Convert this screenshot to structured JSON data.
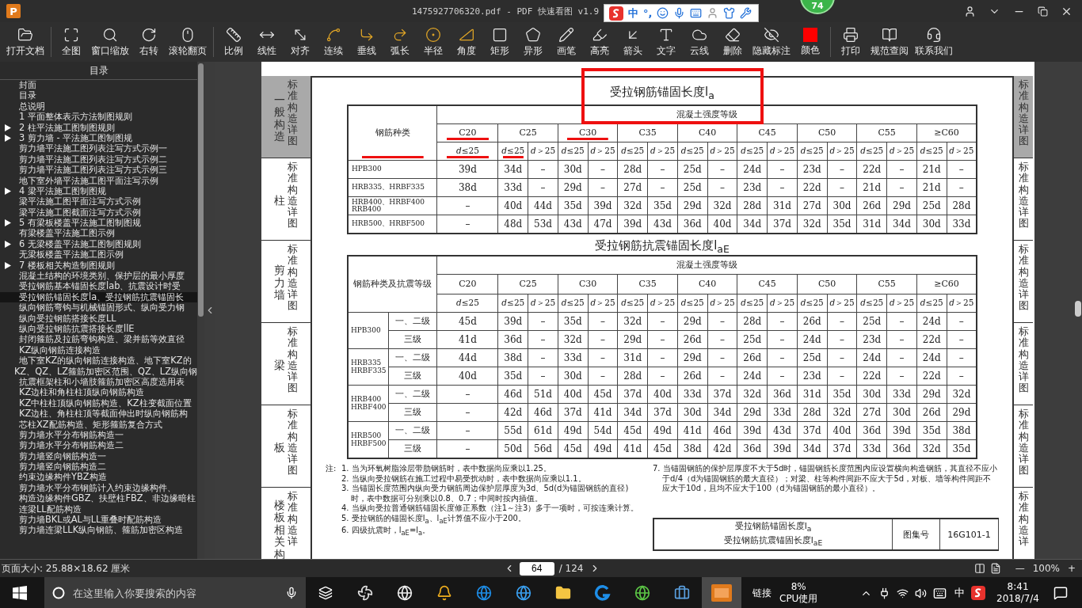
{
  "window": {
    "logo": "P",
    "title": "1475927706320.pdf - PDF 快速看图 v1.9",
    "badge": "74"
  },
  "ime_bar": {
    "mode": "中",
    "punct": "°,"
  },
  "toolbar": {
    "groups": [
      [
        {
          "label": "打开文档"
        }
      ],
      [
        {
          "label": "全图"
        },
        {
          "label": "窗口缩放"
        },
        {
          "label": "右转"
        },
        {
          "label": "滚轮翻页"
        }
      ],
      [
        {
          "label": "比例"
        },
        {
          "label": "线性"
        },
        {
          "label": "对齐"
        },
        {
          "label": "连续"
        },
        {
          "label": "垂线"
        },
        {
          "label": "弧长"
        },
        {
          "label": "半径"
        },
        {
          "label": "角度"
        },
        {
          "label": "矩形"
        },
        {
          "label": "异形"
        },
        {
          "label": "画笔"
        },
        {
          "label": "高亮"
        },
        {
          "label": "箭头"
        },
        {
          "label": "文字"
        },
        {
          "label": "云线"
        },
        {
          "label": "删除"
        },
        {
          "label": "隐藏标注"
        },
        {
          "label": "颜色",
          "color": "#ff0000"
        }
      ],
      [
        {
          "label": "打印"
        },
        {
          "label": "规范查阅"
        },
        {
          "label": "联系我们"
        }
      ]
    ]
  },
  "sidebar": {
    "title": "目录",
    "items": [
      {
        "label": "封面",
        "kind": "page",
        "selected": false
      },
      {
        "label": "目录",
        "kind": "page",
        "selected": false
      },
      {
        "label": "总说明",
        "kind": "page",
        "selected": false
      },
      {
        "label": "1 平面整体表示方法制图规则",
        "kind": "page",
        "selected": false
      },
      {
        "label": "2 柱平法施工图制图规则",
        "kind": "section",
        "expanded": false,
        "selected": false
      },
      {
        "label": "3 剪力墙 - 平法施工图制图规",
        "kind": "section",
        "expanded": false,
        "selected": false
      },
      {
        "label": "剪力墙平法施工图列表注写方式示例一",
        "kind": "page",
        "selected": false
      },
      {
        "label": "剪力墙平法施工图列表注写方式示例二",
        "kind": "page",
        "selected": false
      },
      {
        "label": "剪力墙平法施工图列表注写方式示例三",
        "kind": "page",
        "selected": false
      },
      {
        "label": "地下室外墙平法施工图平面注写示例",
        "kind": "page",
        "selected": false
      },
      {
        "label": "4 梁平法施工图制图规",
        "kind": "section",
        "expanded": false,
        "selected": false
      },
      {
        "label": "梁平法施工图平面注写方式示例",
        "kind": "page",
        "selected": false
      },
      {
        "label": "梁平法施工图截面注写方式示例",
        "kind": "page",
        "selected": false
      },
      {
        "label": "5 有梁板楼盖平法施工图制图规",
        "kind": "section",
        "expanded": false,
        "selected": false
      },
      {
        "label": "有梁楼盖平法施工图示例",
        "kind": "page",
        "selected": false
      },
      {
        "label": "6 无梁楼盖平法施工图制图规则",
        "kind": "section",
        "expanded": false,
        "selected": false
      },
      {
        "label": "无梁板楼盖平法施工图示例",
        "kind": "page",
        "selected": false
      },
      {
        "label": "7 楼板相关构造制图规则",
        "kind": "section",
        "expanded": false,
        "selected": false
      },
      {
        "label": "混凝土结构的环境类别、保护层的最小厚度",
        "kind": "page",
        "selected": false
      },
      {
        "label": "受拉钢筋基本锚固长度lab、抗震设计时受",
        "kind": "page",
        "selected": false
      },
      {
        "label": "受拉钢筋锚固长度la、受拉钢筋抗震锚固长",
        "kind": "page",
        "selected": true
      },
      {
        "label": "纵向钢筋弯钩与机械锚固形式、纵向受力钢",
        "kind": "page",
        "selected": false
      },
      {
        "label": "纵向受拉钢筋搭接长度LL",
        "kind": "page",
        "selected": false
      },
      {
        "label": "纵向受拉钢筋抗震搭接长度llE",
        "kind": "page",
        "selected": false
      },
      {
        "label": "封闭箍筋及拉筋弯钩构造、梁并筋等效直径",
        "kind": "page",
        "selected": false
      },
      {
        "label": "KZ纵向钢筋连接构造",
        "kind": "page",
        "selected": false
      },
      {
        "label": "地下室KZ的纵向钢筋连接构造、地下室KZ的",
        "kind": "page",
        "selected": false
      },
      {
        "label": "KZ、QZ、LZ箍筋加密区范围、QZ、LZ纵向钢",
        "kind": "page",
        "selected": false
      },
      {
        "label": "抗震框架柱和小墙肢箍筋加密区高度选用表",
        "kind": "page",
        "selected": false
      },
      {
        "label": "KZ边柱和角柱柱顶纵向钢筋构造",
        "kind": "page",
        "selected": false
      },
      {
        "label": "KZ中柱柱顶纵向钢筋构造、KZ柱变截面位置",
        "kind": "page",
        "selected": false
      },
      {
        "label": "KZ边柱、角柱柱顶等截面伸出时纵向钢筋构",
        "kind": "page",
        "selected": false
      },
      {
        "label": "芯柱XZ配筋构造、矩形箍筋复合方式",
        "kind": "page",
        "selected": false
      },
      {
        "label": "剪力墙水平分布钢筋构造一",
        "kind": "page",
        "selected": false
      },
      {
        "label": "剪力墙水平分布钢筋构造二",
        "kind": "page",
        "selected": false
      },
      {
        "label": "剪力墙竖向钢筋构造一",
        "kind": "page",
        "selected": false
      },
      {
        "label": "剪力墙竖向钢筋构造二",
        "kind": "page",
        "selected": false
      },
      {
        "label": "约束边缘构件YBZ构造",
        "kind": "page",
        "selected": false
      },
      {
        "label": "剪力墙水平分布钢筋计入约束边缘构件、",
        "kind": "page",
        "selected": false
      },
      {
        "label": "构造边缘构件GBZ、扶壁柱FBZ、非边缘暗柱",
        "kind": "page",
        "selected": false
      },
      {
        "label": "连梁LL配筋构造",
        "kind": "page",
        "selected": false
      },
      {
        "label": "剪力墙BKL或AL与LL重叠时配筋构造",
        "kind": "page",
        "selected": false
      },
      {
        "label": "剪力墙连梁LLK纵向钢筋、箍筋加密区构造",
        "kind": "page",
        "selected": false
      }
    ]
  },
  "document": {
    "left_tabs": [
      {
        "category": "一般构造",
        "label": "标准构造详图",
        "selected": true
      },
      {
        "category": "柱",
        "label": "标准构造详图",
        "selected": false
      },
      {
        "category": "剪力墙",
        "label": "标准构造详图",
        "selected": false
      },
      {
        "category": "梁",
        "label": "标准构造详图",
        "selected": false
      },
      {
        "category": "板",
        "label": "标准构造详图",
        "selected": false
      },
      {
        "category": "楼板相关构",
        "label": "标准构造详",
        "selected": false
      }
    ],
    "right_tabs": [
      {
        "label": "标准构造详图",
        "selected": true
      },
      {
        "label": "标准构造详图",
        "selected": false
      },
      {
        "label": "标准构造详图",
        "selected": false
      },
      {
        "label": "标准构造详图",
        "selected": false
      },
      {
        "label": "标准构造详图",
        "selected": false
      },
      {
        "label": "标准构造详",
        "selected": false
      }
    ],
    "table1": {
      "title": "受拉钢筋锚固长度l$_{a}$",
      "annotated": true,
      "row_header": {
        "label": "钢筋种类",
        "marked": true
      },
      "group_header": "混凝土强度等级",
      "grades": [
        {
          "label": "C20",
          "marked": true,
          "subs": [
            {
              "label": "*d*≤25",
              "marked": true
            }
          ]
        },
        {
          "label": "C25",
          "marked": false,
          "subs": [
            {
              "label": "*d*≤25",
              "marked": true
            },
            {
              "label": "*d*＞25",
              "marked": false
            }
          ]
        },
        {
          "label": "C30",
          "marked": true,
          "subs": [
            {
              "label": "*d*≤25",
              "marked": false
            },
            {
              "label": "*d*＞25",
              "marked": false
            }
          ]
        },
        {
          "label": "C35",
          "marked": false,
          "subs": [
            {
              "label": "*d*≤25",
              "marked": false
            },
            {
              "label": "*d*＞25",
              "marked": false
            }
          ]
        },
        {
          "label": "C40",
          "marked": false,
          "subs": [
            {
              "label": "*d*≤25",
              "marked": false
            },
            {
              "label": "*d*＞25",
              "marked": false
            }
          ]
        },
        {
          "label": "C45",
          "marked": false,
          "subs": [
            {
              "label": "*d*≤25",
              "marked": false
            },
            {
              "label": "*d*＞25",
              "marked": false
            }
          ]
        },
        {
          "label": "C50",
          "marked": false,
          "subs": [
            {
              "label": "*d*≤25",
              "marked": false
            },
            {
              "label": "*d*＞25",
              "marked": false
            }
          ]
        },
        {
          "label": "C55",
          "marked": false,
          "subs": [
            {
              "label": "*d*≤25",
              "marked": false
            },
            {
              "label": "*d*＞25",
              "marked": false
            }
          ]
        },
        {
          "label": "≥C60",
          "marked": false,
          "subs": [
            {
              "label": "*d*≤25",
              "marked": false
            },
            {
              "label": "*d*＞25",
              "marked": false
            }
          ]
        }
      ],
      "rows": [
        {
          "name": "HPB300",
          "values": [
            "39d",
            "34d",
            "–",
            "30d",
            "–",
            "28d",
            "–",
            "25d",
            "–",
            "24d",
            "–",
            "23d",
            "–",
            "22d",
            "–",
            "21d",
            "–"
          ]
        },
        {
          "name": "HRB335、HRBF335",
          "values": [
            "38d",
            "33d",
            "–",
            "29d",
            "–",
            "27d",
            "–",
            "25d",
            "–",
            "23d",
            "–",
            "22d",
            "–",
            "21d",
            "–",
            "21d",
            "–"
          ]
        },
        {
          "name": "HRB400、HRBF400\nRRB400",
          "values": [
            "–",
            "40d",
            "44d",
            "35d",
            "39d",
            "32d",
            "35d",
            "29d",
            "32d",
            "28d",
            "31d",
            "27d",
            "30d",
            "26d",
            "29d",
            "25d",
            "28d"
          ]
        },
        {
          "name": "HRB500、HRBF500",
          "values": [
            "–",
            "48d",
            "53d",
            "43d",
            "47d",
            "39d",
            "43d",
            "36d",
            "40d",
            "34d",
            "37d",
            "32d",
            "35d",
            "31d",
            "34d",
            "30d",
            "33d"
          ]
        }
      ]
    },
    "table2": {
      "title": "受拉钢筋抗震锚固长度l$_{aE}$",
      "row_header": "钢筋种类及抗震等级",
      "group_header": "混凝土强度等级",
      "grades": [
        {
          "label": "C20",
          "subs": [
            "*d*≤25"
          ]
        },
        {
          "label": "C25",
          "subs": [
            "*d*≤25",
            "*d*＞25"
          ]
        },
        {
          "label": "C30",
          "subs": [
            "*d*≤25",
            "*d*＞25"
          ]
        },
        {
          "label": "C35",
          "subs": [
            "*d*≤25",
            "*d*＞25"
          ]
        },
        {
          "label": "C40",
          "subs": [
            "*d*≤25",
            "*d*＞25"
          ]
        },
        {
          "label": "C45",
          "subs": [
            "*d*≤25",
            "*d*＞25"
          ]
        },
        {
          "label": "C50",
          "subs": [
            "*d*≤25",
            "*d*＞25"
          ]
        },
        {
          "label": "C55",
          "subs": [
            "*d*≤25",
            "*d*＞25"
          ]
        },
        {
          "label": "≥C60",
          "subs": [
            "*d*≤25",
            "*d*＞25"
          ]
        }
      ],
      "groups": [
        {
          "name": "HPB300",
          "rows": [
            {
              "level": "一、二级",
              "values": [
                "45d",
                "39d",
                "–",
                "35d",
                "–",
                "32d",
                "–",
                "29d",
                "–",
                "28d",
                "–",
                "26d",
                "–",
                "25d",
                "–",
                "24d",
                "–"
              ]
            },
            {
              "level": "三级",
              "values": [
                "41d",
                "36d",
                "–",
                "32d",
                "–",
                "29d",
                "–",
                "26d",
                "–",
                "25d",
                "–",
                "24d",
                "–",
                "23d",
                "–",
                "22d",
                "–"
              ]
            }
          ]
        },
        {
          "name": "HRB335\nHRBF335",
          "rows": [
            {
              "level": "一、二级",
              "values": [
                "44d",
                "38d",
                "–",
                "33d",
                "–",
                "31d",
                "–",
                "29d",
                "–",
                "26d",
                "–",
                "25d",
                "–",
                "24d",
                "–",
                "24d",
                "–"
              ]
            },
            {
              "level": "三级",
              "values": [
                "40d",
                "35d",
                "–",
                "30d",
                "–",
                "28d",
                "–",
                "26d",
                "–",
                "24d",
                "–",
                "23d",
                "–",
                "22d",
                "–",
                "22d",
                "–"
              ]
            }
          ]
        },
        {
          "name": "HRB400\nHRBF400",
          "rows": [
            {
              "level": "一、二级",
              "values": [
                "–",
                "46d",
                "51d",
                "40d",
                "45d",
                "37d",
                "40d",
                "33d",
                "37d",
                "32d",
                "36d",
                "31d",
                "35d",
                "30d",
                "33d",
                "29d",
                "32d"
              ]
            },
            {
              "level": "三级",
              "values": [
                "–",
                "42d",
                "46d",
                "37d",
                "41d",
                "34d",
                "37d",
                "30d",
                "34d",
                "29d",
                "33d",
                "28d",
                "32d",
                "27d",
                "30d",
                "26d",
                "29d"
              ]
            }
          ]
        },
        {
          "name": "HRB500\nHRBF500",
          "rows": [
            {
              "level": "一、二级",
              "values": [
                "–",
                "55d",
                "61d",
                "49d",
                "54d",
                "45d",
                "49d",
                "41d",
                "46d",
                "39d",
                "43d",
                "37d",
                "40d",
                "36d",
                "39d",
                "35d",
                "38d"
              ]
            },
            {
              "level": "三级",
              "values": [
                "–",
                "50d",
                "56d",
                "45d",
                "49d",
                "41d",
                "45d",
                "38d",
                "42d",
                "36d",
                "39d",
                "34d",
                "37d",
                "33d",
                "36d",
                "32d",
                "35d"
              ]
            }
          ]
        }
      ]
    },
    "notes": {
      "prefix": "注:",
      "left": [
        "1. 当为环氧树脂涂层带肋钢筋时，表中数据尚应乘以1.25。",
        "2. 当纵向受拉钢筋在施工过程中易受扰动时，表中数据尚应乘以1.1。",
        "3. 当锚固长度范围内纵向受力钢筋周边保护层厚度为3d、5d(d为锚固钢筋的直径)时，表中数据可分别乘以0.8、0.7；中间时按内插值。",
        "4. 当纵向受拉普通钢筋锚固长度修正系数（注1～注3）多于一项时，可按连乘计算。",
        "5. 受拉钢筋的锚固长度l$_{a}$、l$_{aE}$计算值不应小于200。",
        "6. 四级抗震时，l$_{aE}$=l$_{a}$。"
      ],
      "right": [
        "7. 当锚固钢筋的保护层厚度不大于5d时，锚固钢筋长度范围内应设置横向构造钢筋，其直径不应小于d/4（d为锚固钢筋的最大直径）；对梁、柱等构件间距不应大于5d，对板、墙等构件间距不应大于10d，且均不应大于100（d为锚固钢筋的最小直径）。"
      ]
    },
    "title_block": {
      "titles": [
        "受拉钢筋锚固长度l$_{a}$",
        "受拉钢筋抗震锚固长度l$_{aE}$"
      ],
      "atlas_label": "图集号",
      "atlas_number": "16G101-1"
    }
  },
  "status_bar": {
    "page_size": "页面大小: 25.88×18.62 厘米",
    "page": "64",
    "total": "/ 124",
    "zoom_out": "—",
    "zoom": "100%",
    "zoom_in": "+"
  },
  "taskbar": {
    "search_placeholder": "在这里输入你要搜索的内容",
    "link": "链接",
    "cpu_value": "8%",
    "cpu_label": "CPU使用",
    "ime": "中",
    "time": "8:41",
    "date": "2018/7/4"
  }
}
